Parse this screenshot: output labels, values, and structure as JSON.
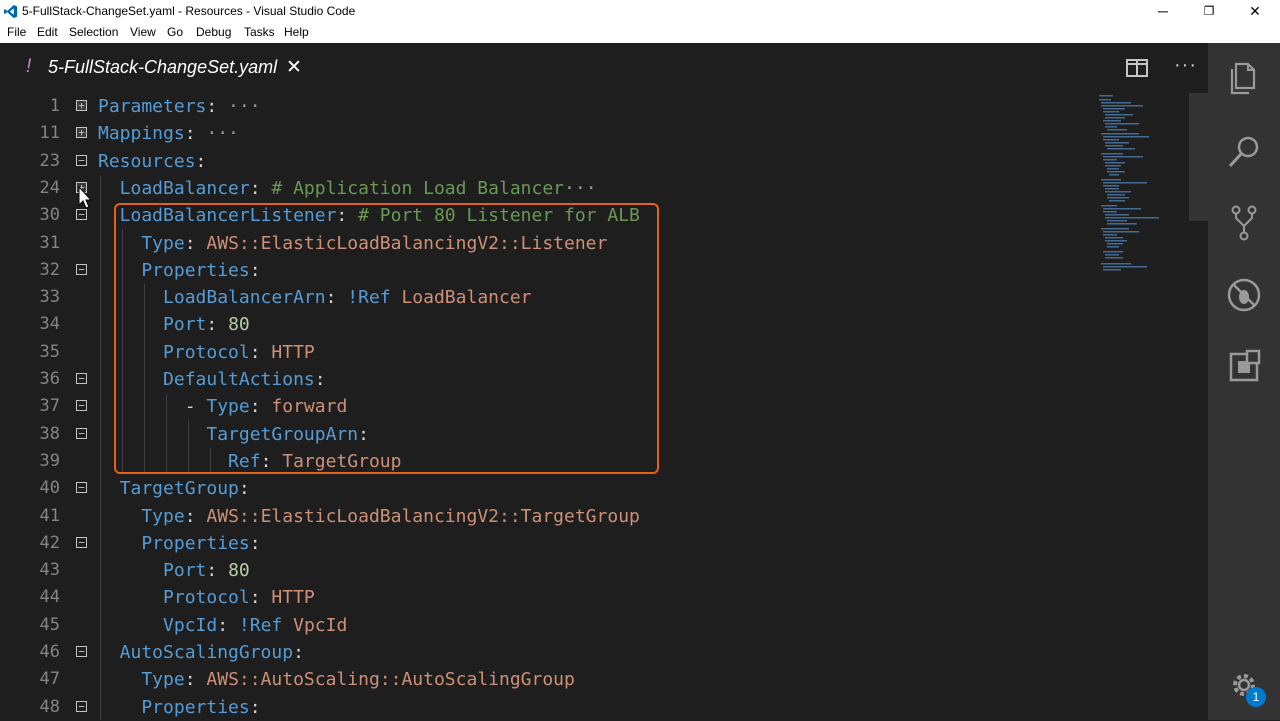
{
  "window": {
    "title": "5-FullStack-ChangeSet.yaml - Resources - Visual Studio Code",
    "minimize": "─",
    "restore": "❐",
    "close": "✕"
  },
  "menu": [
    "File",
    "Edit",
    "Selection",
    "View",
    "Go",
    "Debug",
    "Tasks",
    "Help"
  ],
  "tab": {
    "modified_marker": "!",
    "title": "5-FullStack-ChangeSet.yaml",
    "close": "✕",
    "more": "···"
  },
  "editor": {
    "lines": [
      {
        "num": "1",
        "fold": "+",
        "tokens": [
          {
            "t": "Parameters",
            "c": "k"
          },
          {
            "t": ":",
            "c": "p"
          },
          {
            "t": " ···",
            "c": "e"
          }
        ]
      },
      {
        "num": "11",
        "fold": "+",
        "tokens": [
          {
            "t": "Mappings",
            "c": "k"
          },
          {
            "t": ":",
            "c": "p"
          },
          {
            "t": " ···",
            "c": "e"
          }
        ]
      },
      {
        "num": "23",
        "fold": "−",
        "tokens": [
          {
            "t": "Resources",
            "c": "k"
          },
          {
            "t": ":",
            "c": "p"
          }
        ]
      },
      {
        "num": "24",
        "fold": "+",
        "tokens": [
          {
            "t": "  LoadBalancer",
            "c": "k"
          },
          {
            "t": ": ",
            "c": "p"
          },
          {
            "t": "# Application Load Balancer",
            "c": "c"
          },
          {
            "t": "···",
            "c": "e"
          }
        ]
      },
      {
        "num": "30",
        "fold": "−",
        "tokens": [
          {
            "t": "  LoadBalancerListener",
            "c": "k"
          },
          {
            "t": ": ",
            "c": "p"
          },
          {
            "t": "# Port 80 Listener for ALB",
            "c": "c"
          }
        ]
      },
      {
        "num": "31",
        "fold": "",
        "tokens": [
          {
            "t": "    Type",
            "c": "k"
          },
          {
            "t": ": ",
            "c": "p"
          },
          {
            "t": "AWS::ElasticLoadBalancingV2::Listener",
            "c": "s"
          }
        ]
      },
      {
        "num": "32",
        "fold": "−",
        "tokens": [
          {
            "t": "    Properties",
            "c": "k"
          },
          {
            "t": ":",
            "c": "p"
          }
        ]
      },
      {
        "num": "33",
        "fold": "",
        "tokens": [
          {
            "t": "      LoadBalancerArn",
            "c": "k"
          },
          {
            "t": ": ",
            "c": "p"
          },
          {
            "t": "!Ref",
            "c": "k"
          },
          {
            "t": " LoadBalancer",
            "c": "s"
          }
        ]
      },
      {
        "num": "34",
        "fold": "",
        "tokens": [
          {
            "t": "      Port",
            "c": "k"
          },
          {
            "t": ": ",
            "c": "p"
          },
          {
            "t": "80",
            "c": "n"
          }
        ]
      },
      {
        "num": "35",
        "fold": "",
        "tokens": [
          {
            "t": "      Protocol",
            "c": "k"
          },
          {
            "t": ": ",
            "c": "p"
          },
          {
            "t": "HTTP",
            "c": "s"
          }
        ]
      },
      {
        "num": "36",
        "fold": "−",
        "tokens": [
          {
            "t": "      DefaultActions",
            "c": "k"
          },
          {
            "t": ":",
            "c": "p"
          }
        ]
      },
      {
        "num": "37",
        "fold": "−",
        "tokens": [
          {
            "t": "        - ",
            "c": "p"
          },
          {
            "t": "Type",
            "c": "k"
          },
          {
            "t": ": ",
            "c": "p"
          },
          {
            "t": "forward",
            "c": "s"
          }
        ]
      },
      {
        "num": "38",
        "fold": "−",
        "tokens": [
          {
            "t": "          TargetGroupArn",
            "c": "k"
          },
          {
            "t": ":",
            "c": "p"
          }
        ]
      },
      {
        "num": "39",
        "fold": "",
        "tokens": [
          {
            "t": "            Ref",
            "c": "k"
          },
          {
            "t": ": ",
            "c": "p"
          },
          {
            "t": "TargetGroup",
            "c": "s"
          }
        ]
      },
      {
        "num": "40",
        "fold": "−",
        "tokens": [
          {
            "t": "  TargetGroup",
            "c": "k"
          },
          {
            "t": ":",
            "c": "p"
          }
        ]
      },
      {
        "num": "41",
        "fold": "",
        "tokens": [
          {
            "t": "    Type",
            "c": "k"
          },
          {
            "t": ": ",
            "c": "p"
          },
          {
            "t": "AWS::ElasticLoadBalancingV2::TargetGroup",
            "c": "s"
          }
        ]
      },
      {
        "num": "42",
        "fold": "−",
        "tokens": [
          {
            "t": "    Properties",
            "c": "k"
          },
          {
            "t": ":",
            "c": "p"
          }
        ]
      },
      {
        "num": "43",
        "fold": "",
        "tokens": [
          {
            "t": "      Port",
            "c": "k"
          },
          {
            "t": ": ",
            "c": "p"
          },
          {
            "t": "80",
            "c": "n"
          }
        ]
      },
      {
        "num": "44",
        "fold": "",
        "tokens": [
          {
            "t": "      Protocol",
            "c": "k"
          },
          {
            "t": ": ",
            "c": "p"
          },
          {
            "t": "HTTP",
            "c": "s"
          }
        ]
      },
      {
        "num": "45",
        "fold": "",
        "tokens": [
          {
            "t": "      VpcId",
            "c": "k"
          },
          {
            "t": ": ",
            "c": "p"
          },
          {
            "t": "!Ref",
            "c": "k"
          },
          {
            "t": " VpcId",
            "c": "s"
          }
        ]
      },
      {
        "num": "46",
        "fold": "−",
        "tokens": [
          {
            "t": "  AutoScalingGroup",
            "c": "k"
          },
          {
            "t": ":",
            "c": "p"
          }
        ]
      },
      {
        "num": "47",
        "fold": "",
        "tokens": [
          {
            "t": "    Type",
            "c": "k"
          },
          {
            "t": ": ",
            "c": "p"
          },
          {
            "t": "AWS::AutoScaling::AutoScalingGroup",
            "c": "s"
          }
        ]
      },
      {
        "num": "48",
        "fold": "−",
        "tokens": [
          {
            "t": "    Properties",
            "c": "k"
          },
          {
            "t": ":",
            "c": "p"
          }
        ]
      }
    ]
  },
  "activity_bar": {
    "icons": [
      "explorer-icon",
      "search-icon",
      "source-control-icon",
      "debug-icon",
      "extensions-icon",
      "gear-icon"
    ],
    "settings_badge": "1"
  },
  "colors": {
    "keyword": "#569cd6",
    "string": "#ce9178",
    "number": "#b5cea8",
    "comment": "#6a9955",
    "highlight_border": "#e2621b",
    "badge": "#007acc"
  }
}
